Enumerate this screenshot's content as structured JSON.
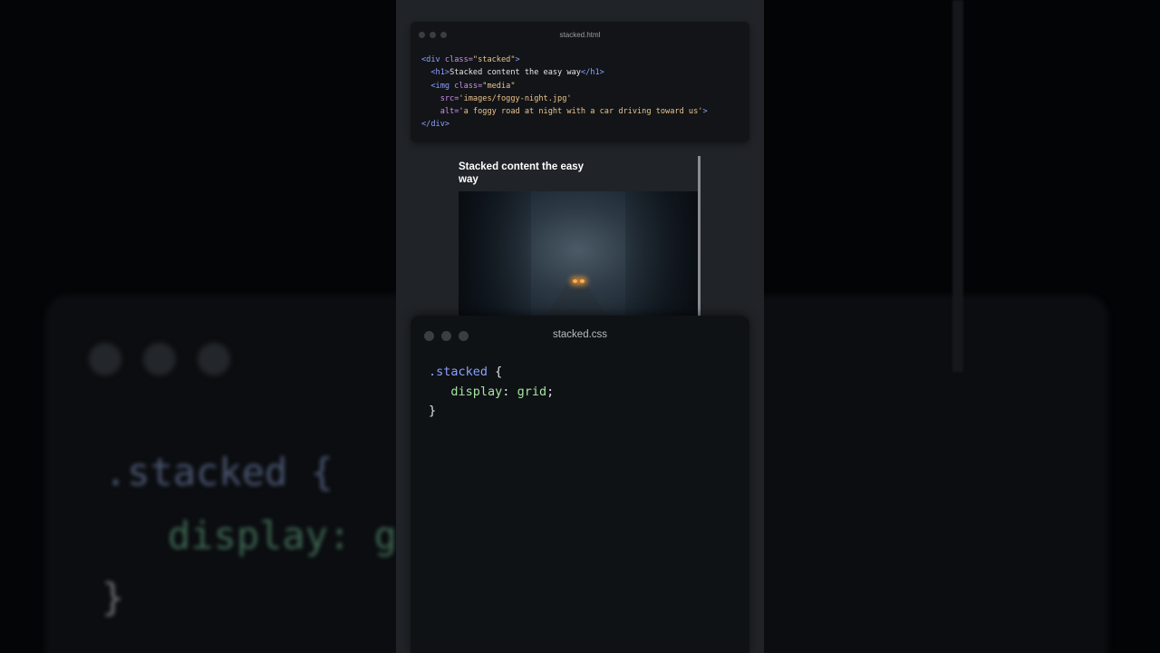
{
  "html_card": {
    "title": "stacked.html",
    "code": {
      "l1_open": "<div ",
      "l1_attr": "class=",
      "l1_val": "\"stacked\"",
      "l1_close": ">",
      "l2_open": "<h1>",
      "l2_text": "Stacked content the easy way",
      "l2_close": "</h1>",
      "l3_open": "<img ",
      "l3_attr": "class=",
      "l3_val": "\"media\"",
      "l4_attr": "src=",
      "l4_val": "'images/foggy-night.jpg'",
      "l5_attr": "alt=",
      "l5_val": "'a foggy road at night with a car driving toward us'",
      "l5_close": ">",
      "l6_close": "</div>"
    }
  },
  "preview": {
    "heading": "Stacked content the easy way",
    "image_colors": {
      "fog": "#4a5a66",
      "headlights": "#ffb347"
    }
  },
  "css_card": {
    "title": "stacked.css",
    "code": {
      "selector": ".stacked",
      "open_brace": "{",
      "property": "display",
      "colon": ":",
      "value": "grid",
      "semicolon": ";",
      "close_brace": "}"
    }
  },
  "background_echo": {
    "selector": ".stacked {",
    "property": "display: g",
    "brace": "}"
  },
  "colors": {
    "tag": "#8aa0ff",
    "attribute": "#c792ea",
    "string": "#ecc48d",
    "property": "#a6e3a1",
    "card_bg": "#121417",
    "page_bg": "#202327"
  }
}
